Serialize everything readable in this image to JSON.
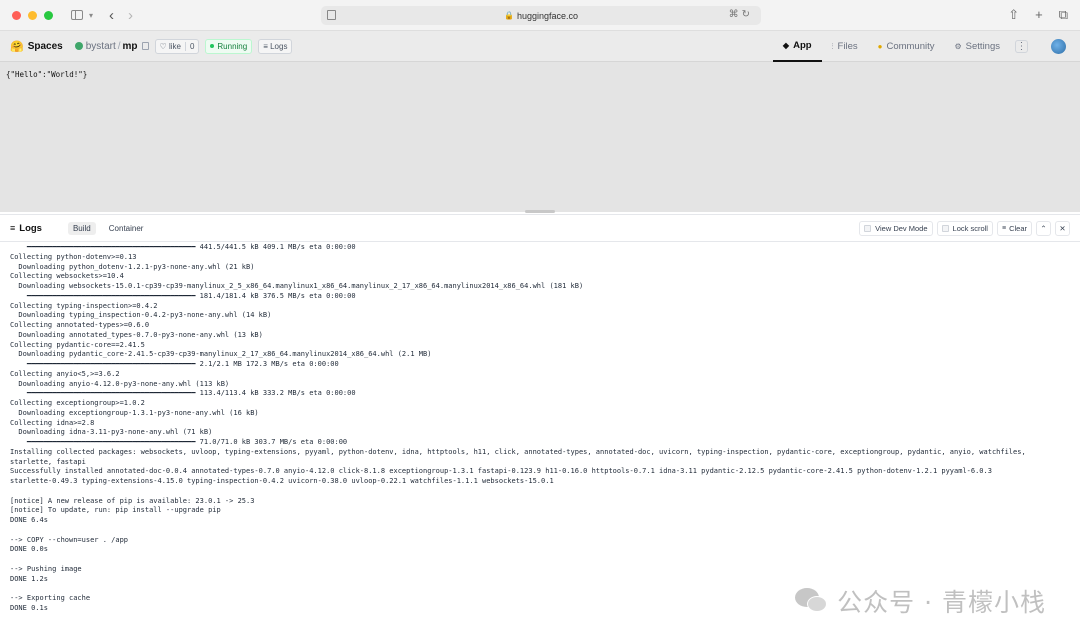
{
  "browser": {
    "url": "huggingface.co"
  },
  "header": {
    "brand": "Spaces",
    "owner": "bystart",
    "space_name": "mp",
    "like_label": "like",
    "like_count": "0",
    "status": "Running",
    "logs_label": "Logs",
    "tabs": [
      {
        "label": "App",
        "icon": "app-icon",
        "active": true
      },
      {
        "label": "Files",
        "icon": "files-icon",
        "active": false
      },
      {
        "label": "Community",
        "icon": "community-icon",
        "active": false
      },
      {
        "label": "Settings",
        "icon": "settings-icon",
        "active": false
      }
    ]
  },
  "app": {
    "output": "{\"Hello\":\"World!\"}"
  },
  "logs": {
    "title": "Logs",
    "tabs": [
      {
        "label": "Build",
        "active": true
      },
      {
        "label": "Container",
        "active": false
      }
    ],
    "actions": {
      "view_dev_mode": "View Dev Mode",
      "lock_scroll": "Lock scroll",
      "clear": "Clear"
    },
    "lines": [
      "    ━━━━━━━━━━━━━━━━━━━━━━━━━━━━━━━━━━━━━━━━ 441.5/441.5 kB 409.1 MB/s eta 0:00:00",
      "Collecting python-dotenv>=0.13",
      "  Downloading python_dotenv-1.2.1-py3-none-any.whl (21 kB)",
      "Collecting websockets>=10.4",
      "  Downloading websockets-15.0.1-cp39-cp39-manylinux_2_5_x86_64.manylinux1_x86_64.manylinux_2_17_x86_64.manylinux2014_x86_64.whl (181 kB)",
      "    ━━━━━━━━━━━━━━━━━━━━━━━━━━━━━━━━━━━━━━━━ 181.4/181.4 kB 376.5 MB/s eta 0:00:00",
      "Collecting typing-inspection>=0.4.2",
      "  Downloading typing_inspection-0.4.2-py3-none-any.whl (14 kB)",
      "Collecting annotated-types>=0.6.0",
      "  Downloading annotated_types-0.7.0-py3-none-any.whl (13 kB)",
      "Collecting pydantic-core==2.41.5",
      "  Downloading pydantic_core-2.41.5-cp39-cp39-manylinux_2_17_x86_64.manylinux2014_x86_64.whl (2.1 MB)",
      "    ━━━━━━━━━━━━━━━━━━━━━━━━━━━━━━━━━━━━━━━━ 2.1/2.1 MB 172.3 MB/s eta 0:00:00",
      "Collecting anyio<5,>=3.6.2",
      "  Downloading anyio-4.12.0-py3-none-any.whl (113 kB)",
      "    ━━━━━━━━━━━━━━━━━━━━━━━━━━━━━━━━━━━━━━━━ 113.4/113.4 kB 333.2 MB/s eta 0:00:00",
      "Collecting exceptiongroup>=1.0.2",
      "  Downloading exceptiongroup-1.3.1-py3-none-any.whl (16 kB)",
      "Collecting idna>=2.8",
      "  Downloading idna-3.11-py3-none-any.whl (71 kB)",
      "    ━━━━━━━━━━━━━━━━━━━━━━━━━━━━━━━━━━━━━━━━ 71.0/71.0 kB 303.7 MB/s eta 0:00:00",
      "Installing collected packages: websockets, uvloop, typing-extensions, pyyaml, python-dotenv, idna, httptools, h11, click, annotated-types, annotated-doc, uvicorn, typing-inspection, pydantic-core, exceptiongroup, pydantic, anyio, watchfiles,",
      "starlette, fastapi",
      "Successfully installed annotated-doc-0.0.4 annotated-types-0.7.0 anyio-4.12.0 click-8.1.8 exceptiongroup-1.3.1 fastapi-0.123.9 h11-0.16.0 httptools-0.7.1 idna-3.11 pydantic-2.12.5 pydantic-core-2.41.5 python-dotenv-1.2.1 pyyaml-6.0.3",
      "starlette-0.49.3 typing-extensions-4.15.0 typing-inspection-0.4.2 uvicorn-0.38.0 uvloop-0.22.1 watchfiles-1.1.1 websockets-15.0.1",
      "",
      "[notice] A new release of pip is available: 23.0.1 -> 25.3",
      "[notice] To update, run: pip install --upgrade pip",
      "DONE 6.4s",
      "",
      "--> COPY --chown=user . /app",
      "DONE 0.0s",
      "",
      "--> Pushing image",
      "DONE 1.2s",
      "",
      "--> Exporting cache",
      "DONE 0.1s"
    ]
  },
  "watermark": {
    "text": "公众号 · 青檬小栈"
  }
}
